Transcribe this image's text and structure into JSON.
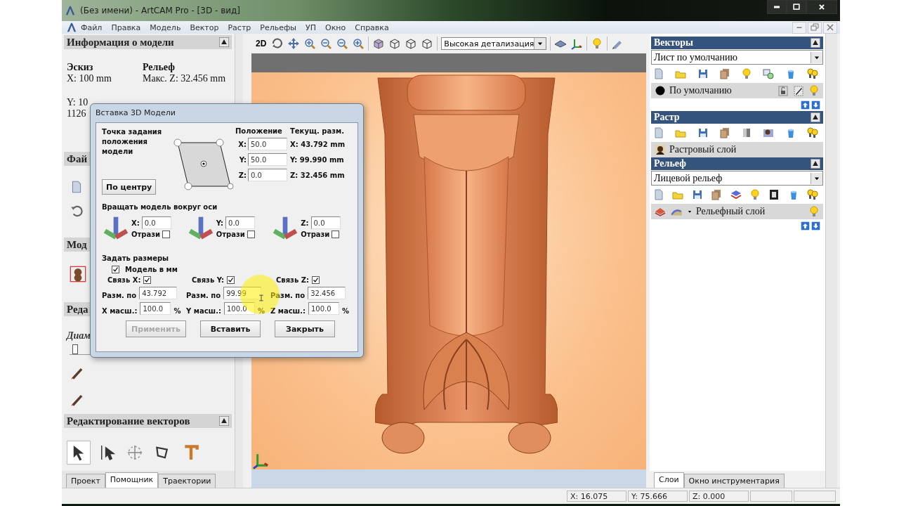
{
  "window": {
    "title": "(Без имени) - ArtCAM Pro - [3D - вид]"
  },
  "menu": [
    "Файл",
    "Правка",
    "Модель",
    "Вектор",
    "Растр",
    "Рельефы",
    "УП",
    "Окно",
    "Справка"
  ],
  "model_info": {
    "title": "Информация о модели",
    "columns": [
      {
        "heading": "Эскиз",
        "blocks": [
          [
            "X: 100 mm"
          ],
          [
            "Y: 10",
            "1126"
          ]
        ]
      },
      {
        "heading": "Рельеф",
        "blocks": [
          [
            "Макс. Z: 32.456 mm"
          ]
        ]
      }
    ]
  },
  "left_sections": [
    {
      "title": "Фай"
    },
    {
      "title": "Мод"
    },
    {
      "title": "Реда"
    }
  ],
  "diameter": {
    "label": "Диам",
    "level": 0.02
  },
  "vector_edit": {
    "title": "Редактирование векторов"
  },
  "left_tabs": [
    {
      "label": "Проект",
      "selected": false
    },
    {
      "label": "Помощник",
      "selected": true
    },
    {
      "label": "Траектории",
      "selected": false
    }
  ],
  "view_toolbar": {
    "mode": "2D",
    "detail": "Высокая детализация"
  },
  "right_panels": [
    {
      "title": "Векторы",
      "select": "Лист по умолчанию",
      "layer": {
        "name": "По умолчанию",
        "kind": "vector"
      },
      "arrows": true
    },
    {
      "title": "Растр",
      "layer": {
        "name": "Растровый слой",
        "kind": "raster"
      },
      "arrows": false
    },
    {
      "title": "Рельеф",
      "select": "Лицевой рельеф",
      "layer": {
        "name": "Рельефный слой",
        "kind": "relief"
      },
      "arrows": true
    }
  ],
  "right_tabs": [
    {
      "label": "Слои",
      "selected": true
    },
    {
      "label": "Окно инструментария",
      "selected": false
    }
  ],
  "status_bar": [
    "X: 16.075",
    "Y: 75.666",
    "Z: 0.000"
  ],
  "dialog": {
    "title": "Вставка 3D Модели",
    "anchor_label": "Точка задания положения модели",
    "center_button": "По центру",
    "position_heading": "Положение",
    "size_heading": "Текущ. разм.",
    "position": [
      {
        "label": "X:",
        "value": "50.0",
        "size": "X: 43.792 mm"
      },
      {
        "label": "Y:",
        "value": "50.0",
        "size": "Y: 99.990 mm"
      },
      {
        "label": "Z:",
        "value": "0.0",
        "size": "Z: 32.456 mm"
      }
    ],
    "rotate_label": "Вращать модель вокруг оси",
    "rotations": [
      {
        "axis": "X:",
        "value": "0.0",
        "mirror_label": "Отрази",
        "checked": false
      },
      {
        "axis": "Y:",
        "value": "0.0",
        "mirror_label": "Отрази",
        "checked": false
      },
      {
        "axis": "Z:",
        "value": "0.0",
        "mirror_label": "Отрази",
        "checked": false
      }
    ],
    "size_label": "Задать размеры",
    "mm_label": "Модель в мм",
    "mm_checked": true,
    "sizes": [
      {
        "link_label": "Связь X:",
        "linked": true,
        "size_label": "Разм. по",
        "size_value": "43.792",
        "scale_label": "X масш.:",
        "scale_value": "100.0",
        "unit": "%"
      },
      {
        "link_label": "Связь Y:",
        "linked": true,
        "size_label": "Разм. по",
        "size_value": "99.99",
        "scale_label": "Y масш.:",
        "scale_value": "100.0",
        "unit": "%"
      },
      {
        "link_label": "Связь Z:",
        "linked": true,
        "size_label": "Разм. по",
        "size_value": "32.456",
        "scale_label": "Z масш.:",
        "scale_value": "100.0",
        "unit": "%"
      }
    ],
    "buttons": [
      {
        "label": "Применить",
        "disabled": true
      },
      {
        "label": "Вставить",
        "disabled": false
      },
      {
        "label": "Закрыть",
        "disabled": false
      }
    ]
  }
}
